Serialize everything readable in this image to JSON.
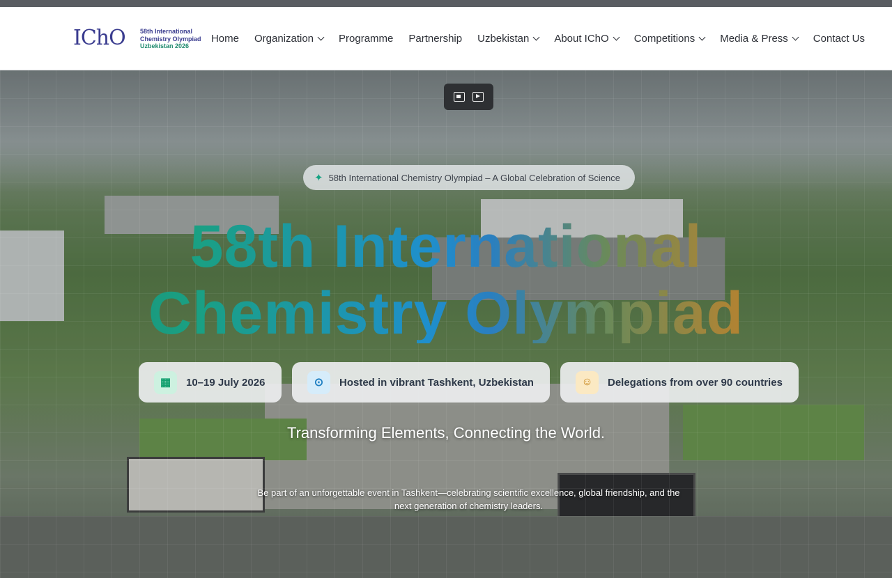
{
  "logo": {
    "mark": "IChO",
    "line1": "58th International",
    "line2": "Chemistry Olympiad",
    "line3": "Uzbekistan 2026"
  },
  "nav": [
    {
      "label": "Home",
      "has_dropdown": false
    },
    {
      "label": "Organization",
      "has_dropdown": true
    },
    {
      "label": "Programme",
      "has_dropdown": false
    },
    {
      "label": "Partnership",
      "has_dropdown": false
    },
    {
      "label": "Uzbekistan",
      "has_dropdown": true
    },
    {
      "label": "About IChO",
      "has_dropdown": true
    },
    {
      "label": "Competitions",
      "has_dropdown": true
    },
    {
      "label": "Media & Press",
      "has_dropdown": true
    },
    {
      "label": "Contact Us",
      "has_dropdown": false
    }
  ],
  "hero": {
    "pill": "58th International Chemistry Olympiad – A Global Celebration of Science",
    "title_line1": "58th International",
    "title_line2": "Chemistry Olympiad",
    "cards": [
      {
        "label": "10–19 July 2026",
        "icon": "calendar-icon"
      },
      {
        "label": "Hosted in vibrant Tashkent, Uzbekistan",
        "icon": "map-pin-icon"
      },
      {
        "label": "Delegations from over 90 countries",
        "icon": "users-icon"
      }
    ],
    "tagline": "Transforming Elements, Connecting the World.",
    "description": "Be part of an unforgettable event in Tashkent—celebrating scientific excellence, global friendship, and the next generation of chemistry leaders."
  },
  "colors": {
    "title_gradient": [
      "#1a8a72",
      "#1f8fcc",
      "#d87b18"
    ],
    "nav_text": "#2c2f36",
    "logo_brand": "#3a3c8f"
  }
}
